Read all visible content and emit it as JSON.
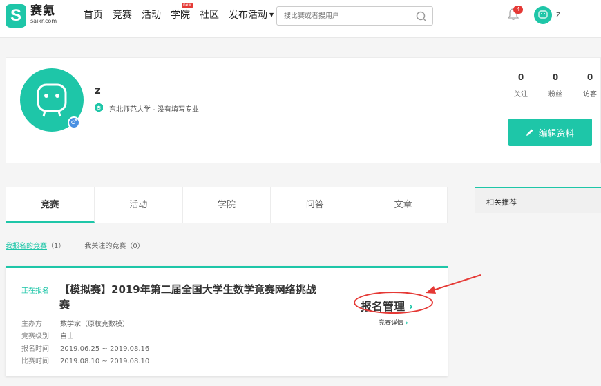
{
  "header": {
    "logo_mark": "S",
    "logo_cn": "赛氪",
    "logo_en": "saikr.com",
    "nav": [
      "首页",
      "竞赛",
      "活动",
      "学院",
      "社区",
      "发布活动"
    ],
    "nav_badge": "new",
    "search_placeholder": "搜比赛或者搜用户",
    "notification_count": "4",
    "username": "z"
  },
  "profile": {
    "name": "z",
    "school": "东北师范大学 - 没有填写专业",
    "gender_symbol": "♂",
    "stats": [
      {
        "num": "0",
        "label": "关注"
      },
      {
        "num": "0",
        "label": "粉丝"
      },
      {
        "num": "0",
        "label": "访客"
      }
    ],
    "edit_label": "编辑资料"
  },
  "tabs": [
    "竞赛",
    "活动",
    "学院",
    "问答",
    "文章"
  ],
  "subtabs": {
    "registered": "我报名的竞赛",
    "registered_count": "（1）",
    "followed": "我关注的竞赛",
    "followed_count": "（0）"
  },
  "sidebar": {
    "title": "相关推荐"
  },
  "competition": {
    "status": "正在报名",
    "title": "【模拟赛】2019年第二届全国大学生数学竞赛网络挑战赛",
    "organizer_label": "主办方",
    "organizer": "数学家（原校克数模）",
    "level_label": "竞赛级别",
    "level": "自由",
    "reg_label": "报名时间",
    "reg_time": "2019.06.25 ~ 2019.08.16",
    "comp_label": "比赛时间",
    "comp_time": "2019.08.10 ~ 2019.08.10",
    "manage_label": "报名管理",
    "detail_label": "竞赛详情"
  },
  "colors": {
    "accent": "#1ec6a8",
    "annotation": "#e53935"
  }
}
